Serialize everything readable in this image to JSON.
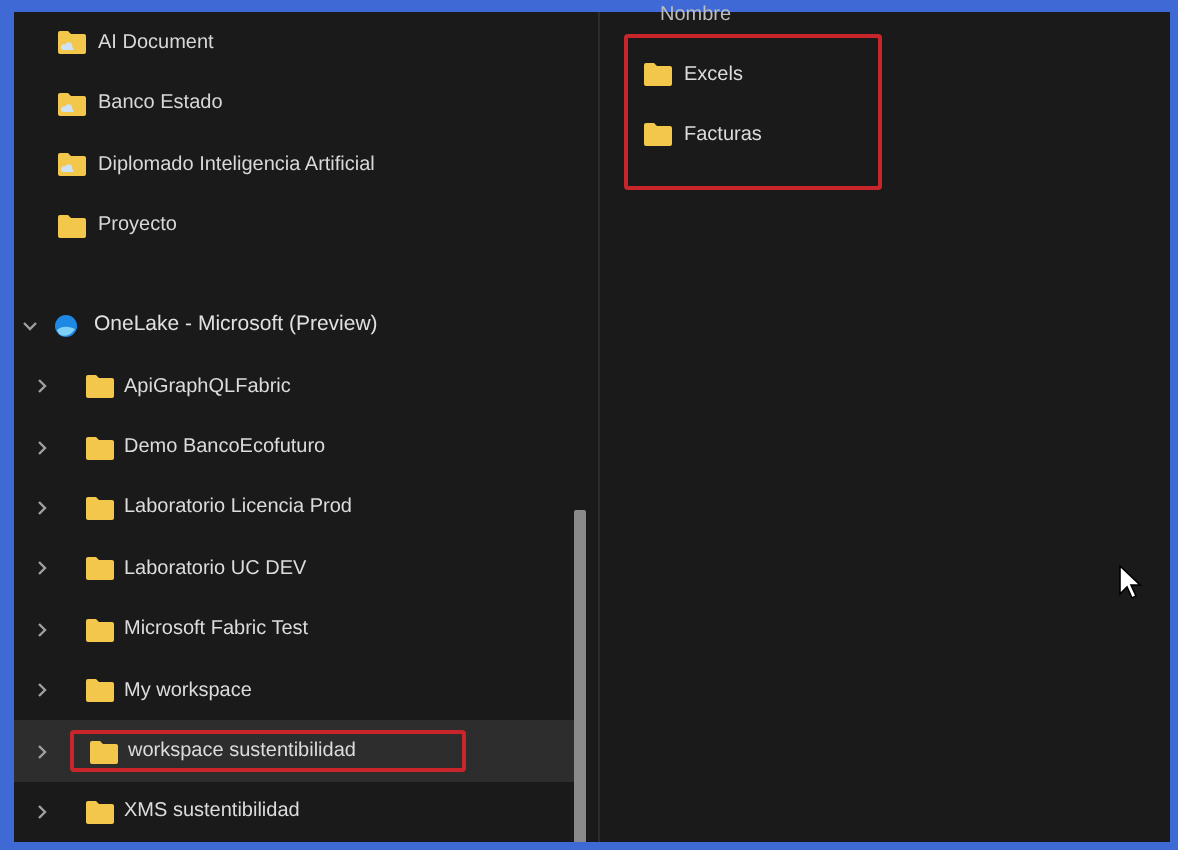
{
  "pinned": [
    {
      "label": "AI Document",
      "kind": "cloud"
    },
    {
      "label": "Banco Estado",
      "kind": "cloud"
    },
    {
      "label": "Diplomado Inteligencia Artificial",
      "kind": "cloud"
    },
    {
      "label": "Proyecto",
      "kind": "plain"
    }
  ],
  "onelake": {
    "label": "OneLake - Microsoft (Preview)",
    "expanded": true,
    "children": [
      {
        "label": "ApiGraphQLFabric",
        "expanded": false,
        "selected": false,
        "highlighted": false
      },
      {
        "label": "Demo BancoEcofuturo",
        "expanded": false,
        "selected": false,
        "highlighted": false
      },
      {
        "label": "Laboratorio Licencia Prod",
        "expanded": false,
        "selected": false,
        "highlighted": false
      },
      {
        "label": "Laboratorio UC DEV",
        "expanded": false,
        "selected": false,
        "highlighted": false
      },
      {
        "label": "Microsoft Fabric Test",
        "expanded": false,
        "selected": false,
        "highlighted": false
      },
      {
        "label": "My workspace",
        "expanded": false,
        "selected": false,
        "highlighted": false
      },
      {
        "label": "workspace sustentibilidad",
        "expanded": false,
        "selected": true,
        "highlighted": true
      },
      {
        "label": "XMS sustentibilidad",
        "expanded": false,
        "selected": false,
        "highlighted": false
      }
    ]
  },
  "content": {
    "column_header": "Nombre",
    "highlighted": true,
    "items": [
      {
        "label": "Excels"
      },
      {
        "label": "Facturas"
      }
    ]
  }
}
